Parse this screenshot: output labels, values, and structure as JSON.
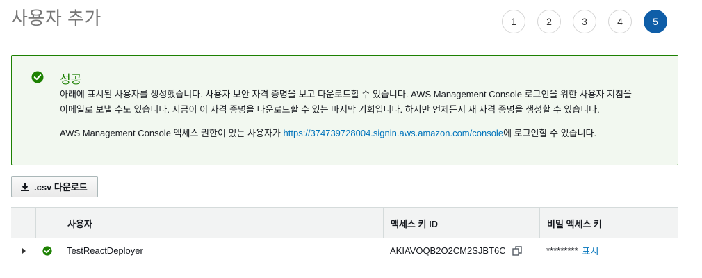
{
  "header": {
    "title": "사용자 추가",
    "steps": [
      "1",
      "2",
      "3",
      "4",
      "5"
    ],
    "active_step": "5"
  },
  "alert": {
    "title": "성공",
    "line1": "아래에 표시된 사용자를 생성했습니다. 사용자 보안 자격 증명을 보고 다운로드할 수 있습니다. AWS Management Console 로그인을 위한 사용자 지침을",
    "line2": "이메일로 보낼 수도 있습니다. 지금이 이 자격 증명을 다운로드할 수 있는 마지막 기회입니다. 하지만 언제든지 새 자격 증명을 생성할 수 있습니다.",
    "console_prefix": "AWS Management Console 액세스 권한이 있는 사용자가 ",
    "console_url": "https://374739728004.signin.aws.amazon.com/console",
    "console_suffix": "에 로그인할 수 있습니다.",
    "icon": "check-circle-icon",
    "color": "#1d8102"
  },
  "toolbar": {
    "csv_label": ".csv 다운로드",
    "csv_icon": "download-icon"
  },
  "table": {
    "headers": [
      "",
      "",
      "사용자",
      "액세스 키 ID",
      "비밀 액세스 키"
    ],
    "rows": [
      {
        "user": "TestReactDeployer",
        "access_key_id": "AKIAVOQB2O2CM2SJBT6C",
        "secret_masked": "*********",
        "show_label": "표시"
      }
    ]
  },
  "colors": {
    "accent": "#0f5ea8",
    "link": "#0073bb",
    "success": "#1d8102"
  }
}
